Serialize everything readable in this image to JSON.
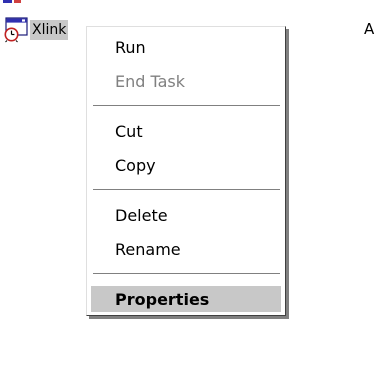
{
  "task": {
    "label": "Xlink",
    "icon": "window-clock-icon"
  },
  "column_header": "A",
  "context_menu": {
    "items": [
      {
        "label": "Run",
        "enabled": true
      },
      {
        "label": "End Task",
        "enabled": false
      },
      {
        "label": "Cut",
        "enabled": true
      },
      {
        "label": "Copy",
        "enabled": true
      },
      {
        "label": "Delete",
        "enabled": true
      },
      {
        "label": "Rename",
        "enabled": true
      },
      {
        "label": "Properties",
        "enabled": true,
        "default": true
      }
    ]
  },
  "colors": {
    "background": "#ffffff",
    "selection": "#c8c8c8",
    "disabled_text": "#808080",
    "icon_blue": "#2f2fb0",
    "icon_red": "#d04040"
  }
}
